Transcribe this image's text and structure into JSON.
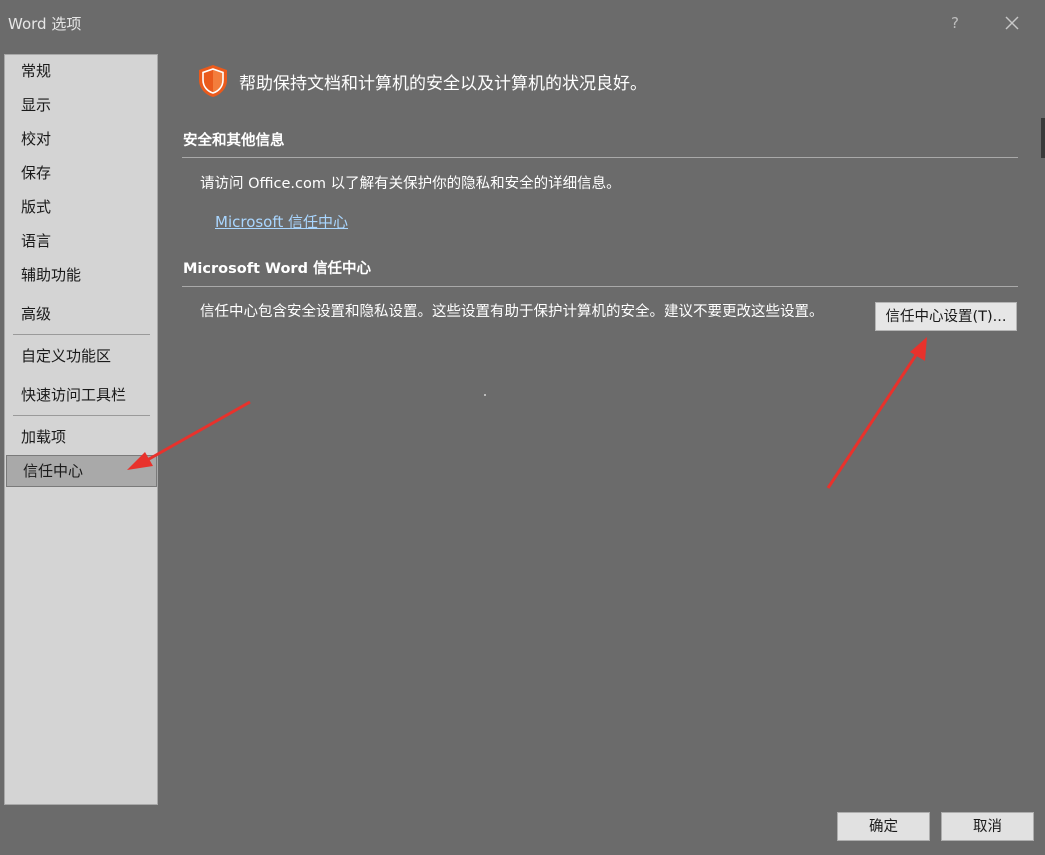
{
  "window": {
    "title": "Word 选项",
    "help_label": "?"
  },
  "sidebar": {
    "items": [
      {
        "label": "常规"
      },
      {
        "label": "显示"
      },
      {
        "label": "校对"
      },
      {
        "label": "保存"
      },
      {
        "label": "版式"
      },
      {
        "label": "语言"
      },
      {
        "label": "辅助功能"
      },
      {
        "label": "高级"
      },
      {
        "label": "自定义功能区"
      },
      {
        "label": "快速访问工具栏"
      },
      {
        "label": "加载项"
      },
      {
        "label": "信任中心"
      }
    ],
    "selected": "信任中心"
  },
  "main": {
    "header": "帮助保持文档和计算机的安全以及计算机的状况良好。",
    "section_privacy": {
      "title": "安全和其他信息",
      "text": "请访问 Office.com 以了解有关保护你的隐私和安全的详细信息。",
      "link": "Microsoft 信任中心"
    },
    "section_trust": {
      "title": "Microsoft Word 信任中心",
      "text": "信任中心包含安全设置和隐私设置。这些设置有助于保护计算机的安全。建议不要更改这些设置。",
      "button": "信任中心设置(T)..."
    }
  },
  "footer": {
    "ok_label": "确定",
    "cancel_label": "取消"
  },
  "colors": {
    "shield": "#ea5a1c",
    "annotation_arrow": "#e8322c",
    "link": "#a9d6ff"
  },
  "icons": {
    "header": "shield-icon",
    "close": "close-icon"
  }
}
